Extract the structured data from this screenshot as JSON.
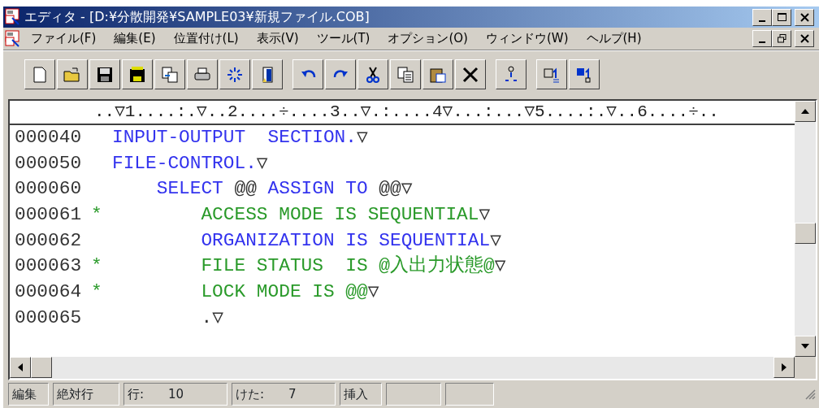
{
  "window": {
    "title": "エディタ - [D:¥分散開発¥SAMPLE03¥新規ファイル.COB]"
  },
  "menu": [
    {
      "label": "ファイル(F)"
    },
    {
      "label": "編集(E)"
    },
    {
      "label": "位置付け(L)"
    },
    {
      "label": "表示(V)"
    },
    {
      "label": "ツール(T)"
    },
    {
      "label": "オプション(O)"
    },
    {
      "label": "ウィンドウ(W)"
    },
    {
      "label": "ヘルプ(H)"
    }
  ],
  "editor": {
    "ruler": "..▽1....:.▽..2....÷....3..▽.:....4▽...:...▽5....:.▽..6....÷..",
    "lines": [
      {
        "number": "000040",
        "commented": false,
        "segments": [
          {
            "kind": "code",
            "text": "INPUT-OUTPUT  SECTION."
          },
          {
            "kind": "eol",
            "text": "▽"
          }
        ]
      },
      {
        "number": "000050",
        "commented": false,
        "segments": [
          {
            "kind": "code",
            "text": "FILE-CONTROL."
          },
          {
            "kind": "eol",
            "text": "▽"
          }
        ]
      },
      {
        "number": "000060",
        "commented": false,
        "segments": [
          {
            "kind": "code",
            "text": "    SELECT "
          },
          {
            "kind": "literal",
            "text": "@@"
          },
          {
            "kind": "code",
            "text": " ASSIGN TO "
          },
          {
            "kind": "literal",
            "text": "@@"
          },
          {
            "kind": "eol",
            "text": "▽"
          }
        ]
      },
      {
        "number": "000061",
        "flag": "*",
        "commented": true,
        "segments": [
          {
            "kind": "code",
            "text": "        ACCESS MODE IS SEQUENTIAL"
          },
          {
            "kind": "eol",
            "text": "▽"
          }
        ]
      },
      {
        "number": "000062",
        "commented": false,
        "segments": [
          {
            "kind": "code",
            "text": "        ORGANIZATION IS SEQUENTIAL"
          },
          {
            "kind": "eol",
            "text": "▽"
          }
        ]
      },
      {
        "number": "000063",
        "flag": "*",
        "commented": true,
        "segments": [
          {
            "kind": "code",
            "text": "        FILE STATUS  IS @入出力状態@"
          },
          {
            "kind": "eol",
            "text": "▽"
          }
        ]
      },
      {
        "number": "000064",
        "flag": "*",
        "commented": true,
        "segments": [
          {
            "kind": "code",
            "text": "        LOCK MODE IS @@"
          },
          {
            "kind": "eol",
            "text": "▽"
          }
        ]
      },
      {
        "number": "000065",
        "commented": false,
        "segments": [
          {
            "kind": "literal",
            "text": "        ."
          },
          {
            "kind": "eol",
            "text": "▽"
          }
        ]
      }
    ]
  },
  "status_bar": [
    {
      "label": "編集"
    },
    {
      "label": "絶対行"
    },
    {
      "label": "行:",
      "value": "10"
    },
    {
      "label": "けた:",
      "value": "7"
    },
    {
      "label": "挿入"
    }
  ]
}
